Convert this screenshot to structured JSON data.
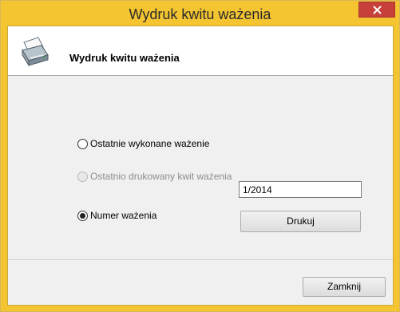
{
  "window": {
    "title": "Wydruk kwitu ważenia",
    "close_symbol": "✕"
  },
  "header": {
    "title": "Wydruk kwitu ważenia",
    "icon": "printer-icon"
  },
  "options": {
    "last_weighing": {
      "label": "Ostatnie wykonane ważenie",
      "checked": false,
      "enabled": true
    },
    "last_printed": {
      "label": "Ostatnio drukowany kwit ważenia",
      "checked": false,
      "enabled": false
    },
    "weighing_number": {
      "label": "Numer ważenia",
      "checked": true,
      "enabled": true,
      "value": "1/2014"
    }
  },
  "buttons": {
    "print_label": "Drukuj",
    "close_label": "Zamknij"
  },
  "colors": {
    "frame": "#f4c431",
    "close_button": "#c7413a"
  }
}
